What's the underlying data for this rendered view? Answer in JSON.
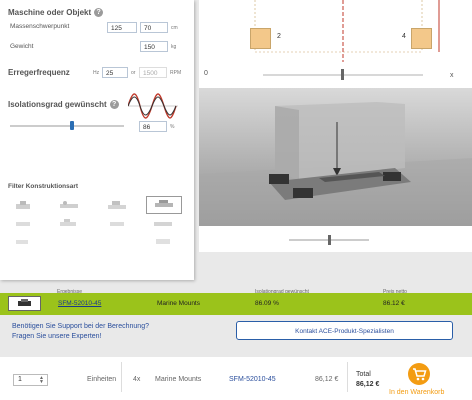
{
  "left": {
    "section_object": "Maschine oder Objekt",
    "label_cog": "Massenschwerpunkt",
    "cog_x": "125",
    "cog_y": "70",
    "cog_unit": "cm",
    "label_weight": "Gewicht",
    "weight": "150",
    "weight_unit": "kg",
    "section_freq": "Erregerfrequenz",
    "hz_label": "Hz",
    "hz_value": "25",
    "or_label": "or",
    "rpm_value": "1500",
    "rpm_label": "RPM",
    "section_iso": "Isolationsgrad gewünscht",
    "iso_value": "86",
    "iso_unit": "%",
    "iso_slider_level": 0.54,
    "filter_title": "Filter Konstruktionsart"
  },
  "viewer": {
    "mount_left_label": "2",
    "mount_right_label": "4",
    "axis_origin": "0",
    "axis_x": "x"
  },
  "results": {
    "col_result": "Ergebnisse",
    "col_iso": "Isolationgrad gewünscht",
    "col_price": "Preis netto",
    "product_link": "SFM-52010-45",
    "product_type": "Marine Mounts",
    "iso_achieved": "86.09 %",
    "price": "86.12 €"
  },
  "support": {
    "line1": "Benötigen Sie Support bei der Berechnung?",
    "line2": "Fragen Sie unsere Experten!",
    "contact_button": "Kontakt ACE-Produkt-Spezialisten"
  },
  "cart": {
    "quantity": "1",
    "units_label": "Einheiten",
    "multiplier": "4x",
    "product_type": "Marine Mounts",
    "product_link": "SFM-52010-45",
    "unit_price": "86,12 €",
    "total_label": "Total",
    "total_value": "86,12 €",
    "add_to_cart": "In den Warenkorb"
  },
  "colors": {
    "accent_green": "#9bc31b",
    "link_blue": "#2a4e9c",
    "cart_orange": "#f39c12",
    "sine_red": "#c0392b"
  }
}
